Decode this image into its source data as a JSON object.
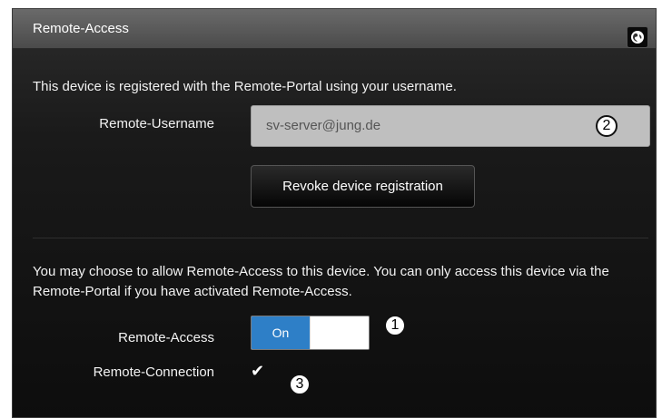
{
  "header": {
    "title": "Remote-Access",
    "globe_icon": "globe-icon"
  },
  "registration": {
    "info": "This device is registered with the Remote-Portal using your username.",
    "username_label": "Remote-Username",
    "username_value": "sv-server@jung.de",
    "revoke_label": "Revoke device registration"
  },
  "access": {
    "info": "You may choose to allow Remote-Access to this device. You can only access this device via the Remote-Portal if you have activated Remote-Access.",
    "remote_access_label": "Remote-Access",
    "toggle_on_label": "On",
    "remote_connection_label": "Remote-Connection",
    "connection_check": "✔"
  },
  "badges": {
    "b1": "1",
    "b2": "2",
    "b3": "3"
  },
  "colors": {
    "accent": "#2e7fc7",
    "panel": "#1a1a1a",
    "header": "#5a5a5a",
    "input_bg": "#bfbfbf"
  }
}
